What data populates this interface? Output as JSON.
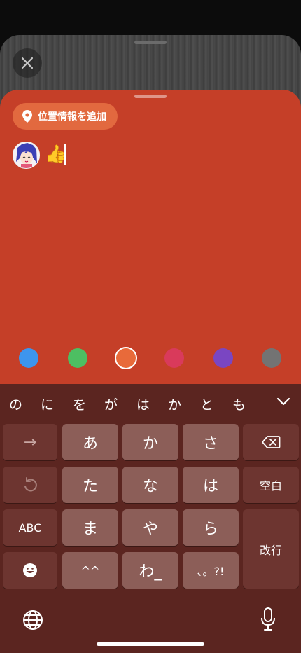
{
  "location_chip": {
    "label": "位置情報を追加",
    "icon": "location-pin-icon"
  },
  "composer": {
    "text": "👍"
  },
  "color_palette": [
    {
      "name": "blue",
      "color": "#3d95ee"
    },
    {
      "name": "green",
      "color": "#4dbf62"
    },
    {
      "name": "orange",
      "color": "#e86a3a",
      "selected": true
    },
    {
      "name": "pink",
      "color": "#d93a5b"
    },
    {
      "name": "purple",
      "color": "#7a46c2"
    },
    {
      "name": "gray",
      "color": "#737373"
    }
  ],
  "keyboard": {
    "suggestions": [
      "の",
      "に",
      "を",
      "が",
      "は",
      "か",
      "と",
      "も"
    ],
    "keys": {
      "arrow": "→",
      "a": "あ",
      "ka": "か",
      "sa": "さ",
      "ta": "た",
      "na": "な",
      "ha": "は",
      "abc": "ABC",
      "ma": "ま",
      "ya": "や",
      "ra": "ら",
      "dakuten": "^^",
      "wa": "わ_",
      "punct": "、。?!",
      "space": "空白",
      "enter": "改行"
    }
  }
}
